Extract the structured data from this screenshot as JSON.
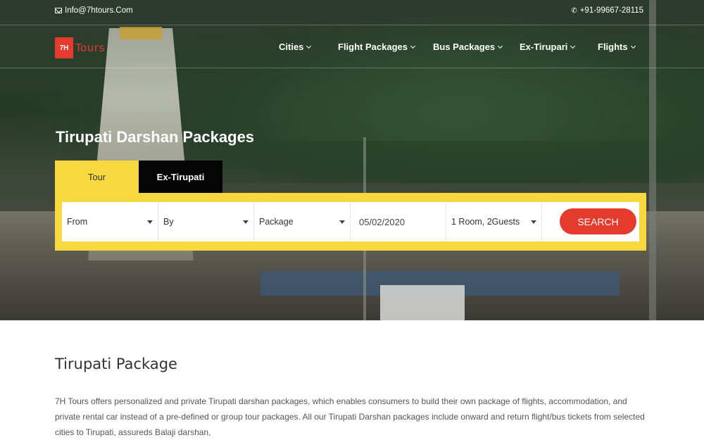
{
  "topbar": {
    "email": "Info@7htours.Com",
    "phone": "+91-99667-28115"
  },
  "brand": {
    "logo_mark": "7H",
    "logo_text": "Tours",
    "color": "#e53a2e"
  },
  "nav": {
    "items": [
      {
        "label": "Cities"
      },
      {
        "label": "Flight Packages"
      },
      {
        "label": "Bus Packages"
      },
      {
        "label": "Ex-Tirupari"
      },
      {
        "label": "Flights"
      }
    ]
  },
  "hero": {
    "title": "Tirupati Darshan Packages"
  },
  "tabs": [
    {
      "label": "Tour",
      "active": true
    },
    {
      "label": "Ex-Tirupati",
      "active": false
    }
  ],
  "search": {
    "from": "From",
    "by": "By",
    "package": "Package",
    "date": "05/02/2020",
    "guests": "1 Room, 2Guests",
    "button": "SEARCH",
    "accent": "#f7d93f"
  },
  "content": {
    "heading": "Tirupati Package",
    "body": "7H Tours offers personalized and private Tirupati darshan packages, which enables consumers to build their own package of flights, accommodation, and private rental car instead of a pre-defined or group tour packages. All our Tirupati Darshan packages include onward and return flight/bus tickets from selected cities to Tirupati, assureds Balaji darshan,"
  }
}
